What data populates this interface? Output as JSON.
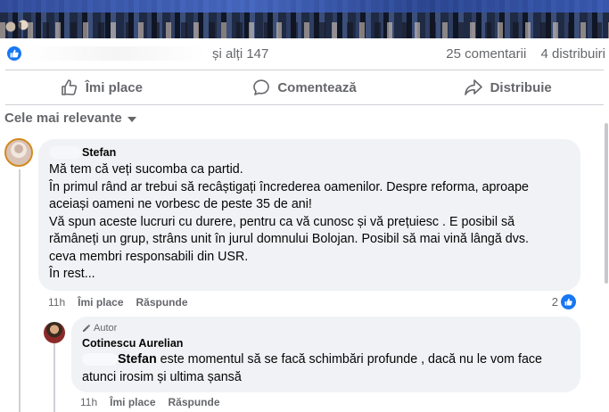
{
  "reactions": {
    "others_text": "și alți 147",
    "comments_count": "25 comentarii",
    "shares_count": "4 distribuiri"
  },
  "actions": {
    "like": "Îmi place",
    "comment": "Comentează",
    "share": "Distribuie"
  },
  "sort_label": "Cele mai relevante",
  "comment": {
    "author": "Stefan",
    "lines": [
      "Mă tem că veți sucomba ca partid.",
      "În primul rând ar trebui să recâștigați încrederea oamenilor. Despre reforma, aproape",
      "aceiași oameni ne vorbesc de peste 35 de ani!",
      "Vă spun aceste lucruri cu durere, pentru ca vă cunosc și vă prețuiesc . E posibil să",
      "rămâneți un grup, strâns unit în jurul domnului Bolojan. Posibil să mai vină lângă dvs.",
      "ceva membri responsabili din USR.",
      "În rest..."
    ],
    "time": "11h",
    "like_label": "Îmi place",
    "reply_label": "Răspunde",
    "reaction_count": "2"
  },
  "reply": {
    "badge": "Autor",
    "author": "Cotinescu Aurelian",
    "mention": "Stefan",
    "text_line1": " este momentul să se facă schimbări profunde , dacă nu le vom face",
    "text_line2": "atunci irosim și ultima șansă",
    "time": "11h",
    "like_label": "Îmi place",
    "reply_label": "Răspunde"
  },
  "colors": {
    "accent": "#1877f2",
    "muted_text": "#65676b",
    "bubble_bg": "#f0f2f5"
  }
}
